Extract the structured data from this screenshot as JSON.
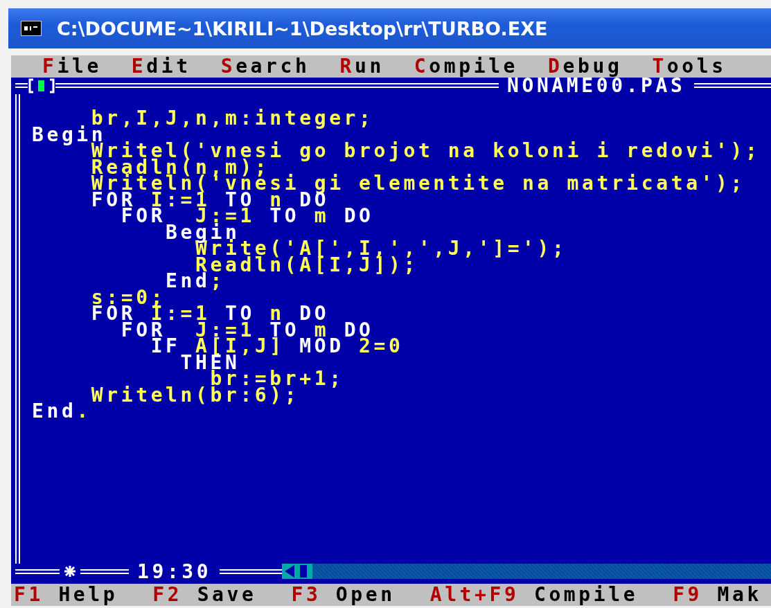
{
  "window": {
    "title": "C:\\DOCUME~1\\KIRILI~1\\Desktop\\rr\\TURBO.EXE"
  },
  "menu": [
    {
      "hotkey": "F",
      "rest": "ile"
    },
    {
      "hotkey": "E",
      "rest": "dit"
    },
    {
      "hotkey": "S",
      "rest": "earch"
    },
    {
      "hotkey": "R",
      "rest": "un"
    },
    {
      "hotkey": "C",
      "rest": "ompile"
    },
    {
      "hotkey": "D",
      "rest": "ebug"
    },
    {
      "hotkey": "T",
      "rest": "ools"
    }
  ],
  "editor": {
    "title": "NONAME00.PAS",
    "time": "19:30",
    "lines": [
      {
        "segments": [
          {
            "kind": "plain",
            "text": "    br,I,J,n,m:integer;"
          }
        ]
      },
      {
        "segments": [
          {
            "kind": "keyword",
            "text": "Begin"
          }
        ]
      },
      {
        "segments": [
          {
            "kind": "plain",
            "text": "    Writel('vnesi go brojot na koloni i redovi');"
          }
        ]
      },
      {
        "segments": [
          {
            "kind": "plain",
            "text": "    Readln(n,m);"
          }
        ]
      },
      {
        "segments": [
          {
            "kind": "plain",
            "text": "    Writeln('vnesi gi elementite na matricata');"
          }
        ]
      },
      {
        "segments": [
          {
            "kind": "keyword",
            "text": "    FOR "
          },
          {
            "kind": "plain",
            "text": "I:=1 "
          },
          {
            "kind": "keyword",
            "text": "TO "
          },
          {
            "kind": "plain",
            "text": "n "
          },
          {
            "kind": "keyword",
            "text": "DO"
          }
        ]
      },
      {
        "segments": [
          {
            "kind": "keyword",
            "text": "      FOR  "
          },
          {
            "kind": "plain",
            "text": "J:=1 "
          },
          {
            "kind": "keyword",
            "text": "TO "
          },
          {
            "kind": "plain",
            "text": "m "
          },
          {
            "kind": "keyword",
            "text": "DO"
          }
        ]
      },
      {
        "segments": [
          {
            "kind": "keyword",
            "text": "         Begin"
          }
        ]
      },
      {
        "segments": [
          {
            "kind": "plain",
            "text": "           Write('A[',I,',',J,']=');"
          }
        ]
      },
      {
        "segments": [
          {
            "kind": "plain",
            "text": "           Readln(A[I,J]);"
          }
        ]
      },
      {
        "segments": [
          {
            "kind": "keyword",
            "text": "         End"
          },
          {
            "kind": "plain",
            "text": ";"
          }
        ]
      },
      {
        "segments": [
          {
            "kind": "plain",
            "text": "    s:=0;"
          }
        ]
      },
      {
        "segments": [
          {
            "kind": "keyword",
            "text": "    FOR "
          },
          {
            "kind": "plain",
            "text": "I:=1 "
          },
          {
            "kind": "keyword",
            "text": "TO "
          },
          {
            "kind": "plain",
            "text": "n "
          },
          {
            "kind": "keyword",
            "text": "DO"
          }
        ]
      },
      {
        "segments": [
          {
            "kind": "keyword",
            "text": "      FOR  "
          },
          {
            "kind": "plain",
            "text": "J:=1 "
          },
          {
            "kind": "keyword",
            "text": "TO "
          },
          {
            "kind": "plain",
            "text": "m "
          },
          {
            "kind": "keyword",
            "text": "DO"
          }
        ]
      },
      {
        "segments": [
          {
            "kind": "keyword",
            "text": "        IF "
          },
          {
            "kind": "plain",
            "text": "A[I,J] "
          },
          {
            "kind": "keyword",
            "text": "MOD "
          },
          {
            "kind": "plain",
            "text": "2=0"
          }
        ]
      },
      {
        "segments": [
          {
            "kind": "keyword",
            "text": "          THEN"
          }
        ]
      },
      {
        "segments": [
          {
            "kind": "plain",
            "text": "            br:=br+1;"
          }
        ]
      },
      {
        "segments": [
          {
            "kind": "plain",
            "text": "    Writeln(br:6);"
          }
        ]
      },
      {
        "segments": [
          {
            "kind": "keyword",
            "text": "End"
          },
          {
            "kind": "plain",
            "text": "."
          }
        ]
      }
    ]
  },
  "status_bar": [
    {
      "key": "F1",
      "label": "Help"
    },
    {
      "key": "F2",
      "label": "Save"
    },
    {
      "key": "F3",
      "label": "Open"
    },
    {
      "key": "Alt+F9",
      "label": "Compile"
    },
    {
      "key": "F9",
      "label": "Mak"
    }
  ]
}
